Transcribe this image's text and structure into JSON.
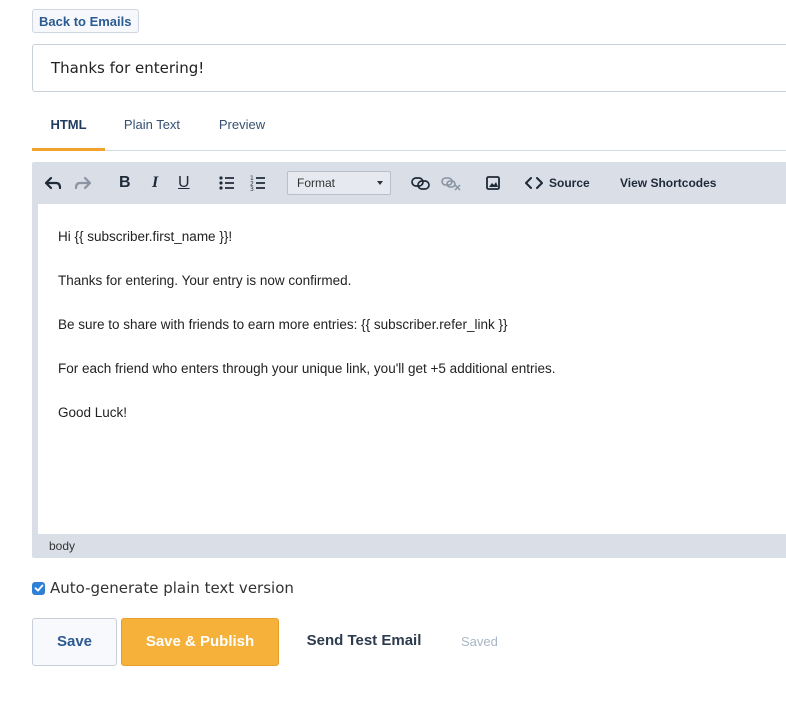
{
  "header": {
    "back_label": "Back to Emails"
  },
  "subject": {
    "value": "Thanks for entering!"
  },
  "tabs": [
    {
      "label": "HTML",
      "active": true
    },
    {
      "label": "Plain Text",
      "active": false
    },
    {
      "label": "Preview",
      "active": false
    }
  ],
  "toolbar": {
    "icons": [
      "undo-icon",
      "redo-icon",
      "bold-icon",
      "italic-icon",
      "underline-icon",
      "bullet-list-icon",
      "numbered-list-icon",
      "link-icon",
      "unlink-icon",
      "image-icon",
      "code-icon"
    ],
    "bold": "B",
    "italic": "I",
    "underline": "U",
    "format_value": "Format",
    "source_label": "Source",
    "shortcodes_label": "View Shortcodes"
  },
  "editor": {
    "paragraphs": [
      "Hi {{ subscriber.first_name }}!",
      "Thanks for entering. Your entry is now confirmed.",
      "Be sure to share with friends to earn more entries: {{ subscriber.refer_link }}",
      "For each friend who enters through your unique link, you'll get +5 additional entries.",
      "Good Luck!"
    ],
    "status_path": "body"
  },
  "options": {
    "autogen_label": "Auto-generate plain text version",
    "autogen_checked": true
  },
  "actions": {
    "save_label": "Save",
    "publish_label": "Save & Publish",
    "test_label": "Send Test Email",
    "saved_status": "Saved"
  },
  "colors": {
    "accent": "#f5b13a",
    "primary": "#2c5b93",
    "editor_bg": "#d9dee7",
    "checkbox": "#2f7fd6"
  }
}
